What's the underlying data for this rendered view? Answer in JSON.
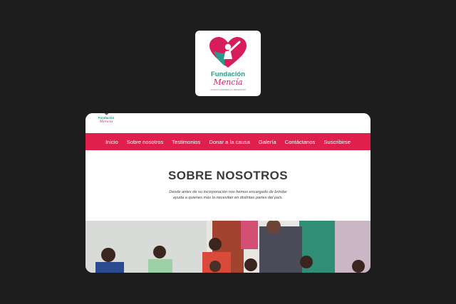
{
  "logo": {
    "name": "Fundación",
    "script": "Mencía",
    "tagline": "AYUDA A QUIENES LO NECESITAN",
    "colors": {
      "heart": "#d71d5b",
      "figure": "#2a9a8a"
    }
  },
  "site": {
    "header_logo": {
      "name": "Fundación",
      "script": "Mencía"
    },
    "nav": [
      "Inicio",
      "Sobre nosotros",
      "Testimonios",
      "Donar a la causa",
      "Galería",
      "Contáctanos",
      "Suscribirse"
    ],
    "nav_color": "#e01f4c",
    "about": {
      "title": "SOBRE NOSOTROS",
      "text_line1": "Desde antes de su incorporación nos hemos encargado de brindar",
      "text_line2": "ayuda a quienes más lo necesitan en distintas partes del país."
    }
  }
}
